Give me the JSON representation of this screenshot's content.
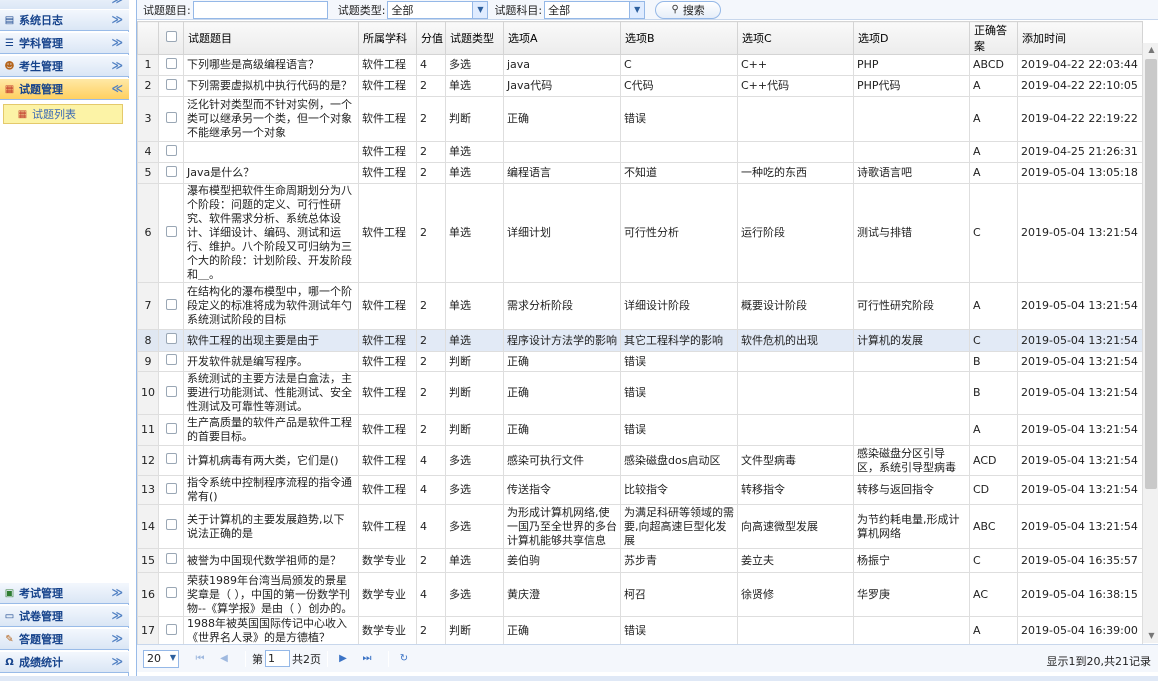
{
  "sidebar": {
    "top_menu": [
      {
        "label": "系统日志",
        "icon": "log-icon"
      },
      {
        "label": "学科管理",
        "icon": "list-icon"
      },
      {
        "label": "考生管理",
        "icon": "users-icon"
      },
      {
        "label": "试题管理",
        "icon": "calendar-icon",
        "active": true
      }
    ],
    "sub_item": {
      "label": "试题列表",
      "icon": "calendar-small-icon"
    },
    "bottom_menu": [
      {
        "label": "考试管理",
        "icon": "exam-icon"
      },
      {
        "label": "试卷管理",
        "icon": "paper-icon"
      },
      {
        "label": "答题管理",
        "icon": "answer-icon"
      },
      {
        "label": "成绩统计",
        "icon": "headset-icon"
      }
    ]
  },
  "toolbar": {
    "title_label": "试题题目:",
    "title_value": "",
    "type_label": "试题类型:",
    "type_value": "全部",
    "subject_label": "试题科目:",
    "subject_value": "全部",
    "search_label": "搜索"
  },
  "table": {
    "columns": [
      "试题题目",
      "所属学科",
      "分值",
      "试题类型",
      "选项A",
      "选项B",
      "选项C",
      "选项D",
      "正确答案",
      "添加时间"
    ],
    "rows": [
      {
        "n": "1",
        "title": "下列哪些是高级编程语言？",
        "subject": "软件工程",
        "score": "4",
        "type": "多选",
        "a": "java",
        "b": "C",
        "c": "C++",
        "d": "PHP",
        "ans": "ABCD",
        "time": "2019-04-22 22:03:44"
      },
      {
        "n": "2",
        "title": "下列需要虚拟机中执行代码的是？",
        "subject": "软件工程",
        "score": "2",
        "type": "单选",
        "a": "Java代码",
        "b": "C代码",
        "c": "C++代码",
        "d": "PHP代码",
        "ans": "A",
        "time": "2019-04-22 22:10:05"
      },
      {
        "n": "3",
        "title": "泛化针对类型而不针对实例，一个类可以继承另一个类，但一个对象不能继承另一个对象",
        "subject": "软件工程",
        "score": "2",
        "type": "判断",
        "a": "正确",
        "b": "错误",
        "c": "",
        "d": "",
        "ans": "A",
        "time": "2019-04-22 22:19:22"
      },
      {
        "n": "4",
        "title": "",
        "subject": "软件工程",
        "score": "2",
        "type": "单选",
        "a": "",
        "b": "",
        "c": "",
        "d": "",
        "ans": "A",
        "time": "2019-04-25 21:26:31"
      },
      {
        "n": "5",
        "title": "Java是什么？",
        "subject": "软件工程",
        "score": "2",
        "type": "单选",
        "a": "编程语言",
        "b": "不知道",
        "c": "一种吃的东西",
        "d": "诗歌语言吧",
        "ans": "A",
        "time": "2019-05-04 13:05:18"
      },
      {
        "n": "6",
        "title": "瀑布模型把软件生命周期划分为八个阶段：问题的定义、可行性研究、软件需求分析、系统总体设计、详细设计、编码、测试和运行、维护。八个阶段又可归纳为三个大的阶段：计划阶段、开发阶段和＿。",
        "subject": "软件工程",
        "score": "2",
        "type": "单选",
        "a": "详细计划",
        "b": "可行性分析",
        "c": "运行阶段",
        "d": "测试与排错",
        "ans": "C",
        "time": "2019-05-04 13:21:54"
      },
      {
        "n": "7",
        "title": "在结构化的瀑布模型中，哪一个阶段定义的标准将成为软件测试年勺系统测试阶段的目标",
        "subject": "软件工程",
        "score": "2",
        "type": "单选",
        "a": "需求分析阶段",
        "b": "详细设计阶段",
        "c": "概要设计阶段",
        "d": "可行性研究阶段",
        "ans": "A",
        "time": "2019-05-04 13:21:54"
      },
      {
        "n": "8",
        "title": "软件工程的出现主要是由于",
        "subject": "软件工程",
        "score": "2",
        "type": "单选",
        "a": "程序设计方法学的影响",
        "b": "其它工程科学的影响",
        "c": "软件危机的出现",
        "d": "计算机的发展",
        "ans": "C",
        "time": "2019-05-04 13:21:54"
      },
      {
        "n": "9",
        "title": "开发软件就是编写程序。",
        "subject": "软件工程",
        "score": "2",
        "type": "判断",
        "a": "正确",
        "b": "错误",
        "c": "",
        "d": "",
        "ans": "B",
        "time": "2019-05-04 13:21:54"
      },
      {
        "n": "10",
        "title": "系统测试的主要方法是白盒法，主要进行功能测试、性能测试、安全性测试及可靠性等测试。",
        "subject": "软件工程",
        "score": "2",
        "type": "判断",
        "a": "正确",
        "b": "错误",
        "c": "",
        "d": "",
        "ans": "B",
        "time": "2019-05-04 13:21:54"
      },
      {
        "n": "11",
        "title": "生产高质量的软件产品是软件工程的首要目标。",
        "subject": "软件工程",
        "score": "2",
        "type": "判断",
        "a": "正确",
        "b": "错误",
        "c": "",
        "d": "",
        "ans": "A",
        "time": "2019-05-04 13:21:54"
      },
      {
        "n": "12",
        "title": "计算机病毒有两大类，它们是()",
        "subject": "软件工程",
        "score": "4",
        "type": "多选",
        "a": "感染可执行文件",
        "b": "感染磁盘dos启动区",
        "c": "文件型病毒",
        "d": "感染磁盘分区引导区，系统引导型病毒",
        "ans": "ACD",
        "time": "2019-05-04 13:21:54"
      },
      {
        "n": "13",
        "title": "指令系统中控制程序流程的指令通常有()",
        "subject": "软件工程",
        "score": "4",
        "type": "多选",
        "a": "传送指令",
        "b": "比较指令",
        "c": "转移指令",
        "d": "转移与返回指令",
        "ans": "CD",
        "time": "2019-05-04 13:21:54"
      },
      {
        "n": "14",
        "title": "关于计算机的主要发展趋势,以下说法正确的是",
        "subject": "软件工程",
        "score": "4",
        "type": "多选",
        "a": "为形成计算机网络,使一国乃至全世界的多台计算机能够共享信息",
        "b": "为满足科研等领域的需要,向超高速巨型化发展",
        "c": "向高速微型发展",
        "d": "为节约耗电量,形成计算机网络",
        "ans": "ABC",
        "time": "2019-05-04 13:21:54"
      },
      {
        "n": "15",
        "title": "被誉为中国现代数学祖师的是？",
        "subject": "数学专业",
        "score": "2",
        "type": "单选",
        "a": "姜伯驹",
        "b": "苏步青",
        "c": "姜立夫",
        "d": "杨振宁",
        "ans": "C",
        "time": "2019-05-04 16:35:57"
      },
      {
        "n": "16",
        "title": "荣获1989年台湾当局颁发的景星奖章是（ ），中国的第一份数学刊物--《算学报》是由（ ）创办的。",
        "subject": "数学专业",
        "score": "4",
        "type": "多选",
        "a": "黄庆澄",
        "b": "柯召",
        "c": "徐贤修",
        "d": "华罗庚",
        "ans": "AC",
        "time": "2019-05-04 16:38:15"
      },
      {
        "n": "17",
        "title": "1988年被英国国际传记中心收入《世界名人录》的是方德植？",
        "subject": "数学专业",
        "score": "2",
        "type": "判断",
        "a": "正确",
        "b": "错误",
        "c": "",
        "d": "",
        "ans": "A",
        "time": "2019-05-04 16:39:00"
      }
    ]
  },
  "pager": {
    "page_size": "20",
    "page_prefix": "第",
    "page_value": "1",
    "page_suffix": "共2页",
    "info": "显示1到20,共21记录"
  },
  "colors": {
    "accent": "#15428b",
    "active_header": "#ffd060",
    "border": "#99bbe8",
    "selected_row": "#e2eaf6"
  }
}
